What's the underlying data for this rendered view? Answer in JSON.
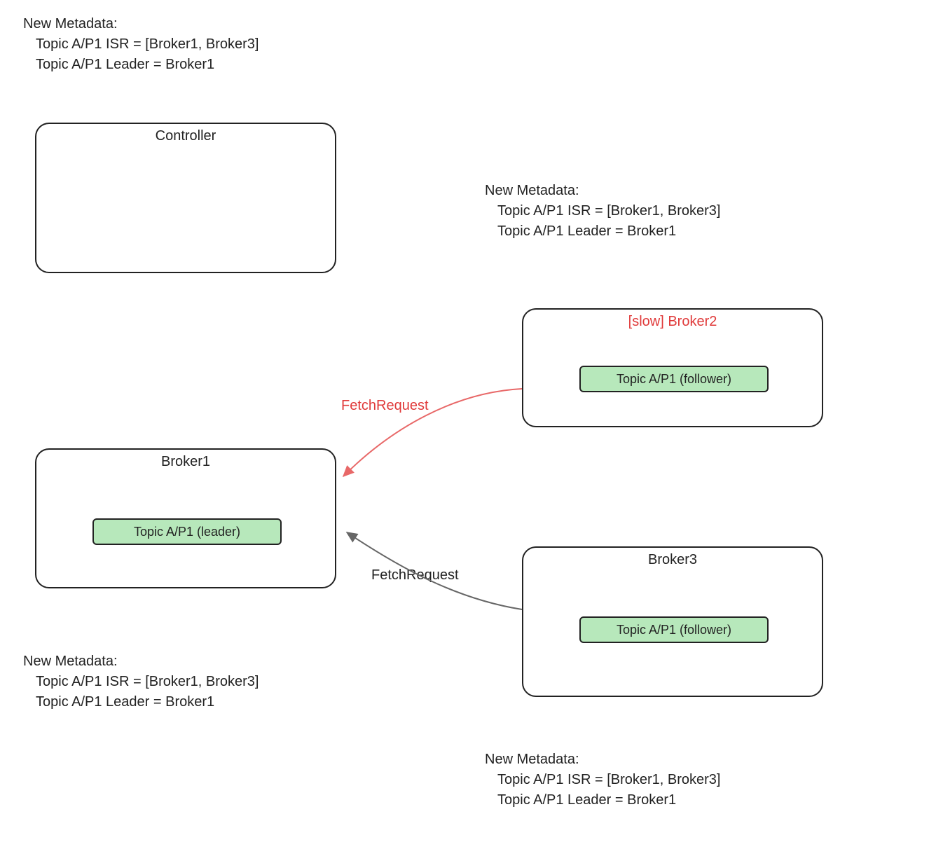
{
  "metadata_blocks": {
    "top_left": {
      "heading": "New Metadata:",
      "line1": "Topic A/P1 ISR = [Broker1, Broker3]",
      "line2": "Topic A/P1 Leader = Broker1"
    },
    "top_right": {
      "heading": "New Metadata:",
      "line1": "Topic A/P1 ISR = [Broker1, Broker3]",
      "line2": "Topic A/P1 Leader = Broker1"
    },
    "bottom_left": {
      "heading": "New Metadata:",
      "line1": "Topic A/P1 ISR = [Broker1, Broker3]",
      "line2": "Topic A/P1 Leader = Broker1"
    },
    "bottom_right": {
      "heading": "New Metadata:",
      "line1": "Topic A/P1 ISR = [Broker1, Broker3]",
      "line2": "Topic A/P1 Leader = Broker1"
    }
  },
  "controller": {
    "title": "Controller"
  },
  "broker1": {
    "title": "Broker1",
    "topic": "Topic A/P1 (leader)"
  },
  "broker2": {
    "title": "[slow] Broker2",
    "topic": "Topic A/P1 (follower)"
  },
  "broker3": {
    "title": "Broker3",
    "topic": "Topic A/P1 (follower)"
  },
  "edges": {
    "fetch_broker2": "FetchRequest",
    "fetch_broker3": "FetchRequest"
  },
  "colors": {
    "pill_bg": "#b7e8bb",
    "red": "#e03a3a",
    "stroke": "#555555"
  }
}
